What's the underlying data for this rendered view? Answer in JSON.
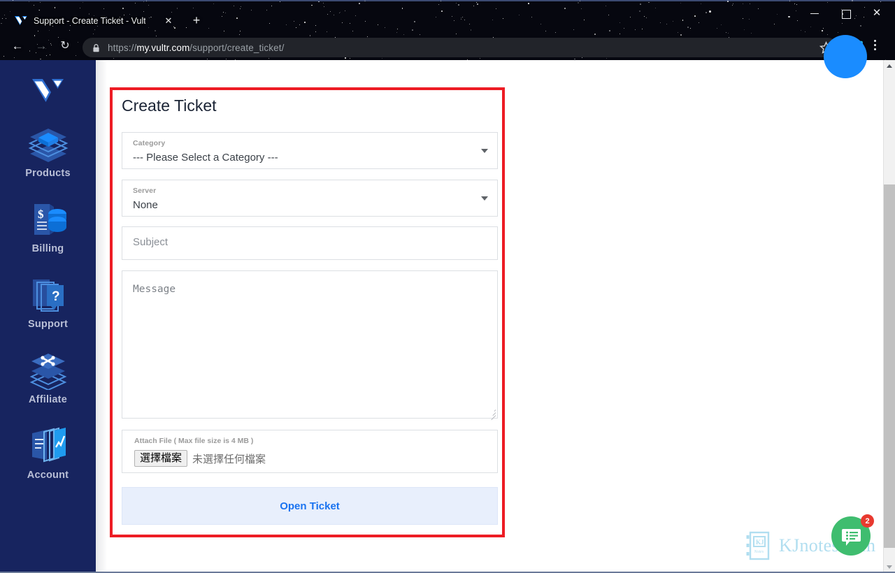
{
  "browser": {
    "tab": {
      "title": "Support - Create Ticket - Vultr.c",
      "favicon": "vultr-logo-icon",
      "close_label": "✕"
    },
    "new_tab_label": "+",
    "window_controls": {
      "minimize": "minimize-icon",
      "maximize": "maximize-icon",
      "close": "✕"
    },
    "nav": {
      "back": "←",
      "forward": "→",
      "reload": "↻"
    },
    "omnibox": {
      "lock": "lock-icon",
      "url_scheme": "https://",
      "url_host": "my.vultr.com",
      "url_path": "/support/create_ticket/"
    },
    "bookmark_star": "star-icon",
    "extension": "kjnotes-extension-icon",
    "menu": "three-dot-menu-icon"
  },
  "sidebar": {
    "logo": "vultr-logo",
    "items": [
      {
        "label": "Products",
        "icon": "layers-cube-icon"
      },
      {
        "label": "Billing",
        "icon": "invoice-coins-icon"
      },
      {
        "label": "Support",
        "icon": "layers-question-icon"
      },
      {
        "label": "Affiliate",
        "icon": "layers-share-icon"
      },
      {
        "label": "Account",
        "icon": "documents-chart-icon"
      }
    ]
  },
  "page": {
    "title": "Create Ticket",
    "fields": {
      "category": {
        "label": "Category",
        "value": "--- Please Select a Category ---",
        "caret": "chevron-down-icon"
      },
      "server": {
        "label": "Server",
        "value": "None",
        "caret": "chevron-down-icon"
      },
      "subject": {
        "placeholder": "Subject",
        "value": ""
      },
      "message": {
        "placeholder": "Message",
        "value": ""
      },
      "attach": {
        "label": "Attach File ( Max file size is 4 MB )",
        "button_label": "選擇檔案",
        "status_text": "未選擇任何檔案"
      }
    },
    "submit_label": "Open Ticket"
  },
  "overlays": {
    "watermark_text": "KJnotes.com",
    "watermark_mark_line1": "KJ",
    "watermark_mark_line2": "Notes",
    "chat": {
      "icon": "chat-list-bubble-icon",
      "badge": "2"
    },
    "top_avatar": "account-avatar-circle"
  },
  "colors": {
    "sidebar_bg": "#17245f",
    "highlight_border": "#ed1c24",
    "submit_bg": "#e8effc",
    "submit_text": "#1a73f0",
    "chat_green": "#3fbd6f",
    "badge_red": "#e8392f",
    "accent_blue": "#1a8cff"
  },
  "scrollbar": {
    "up_arrow": "arrow-up-icon",
    "down_arrow": "arrow-down-icon"
  }
}
